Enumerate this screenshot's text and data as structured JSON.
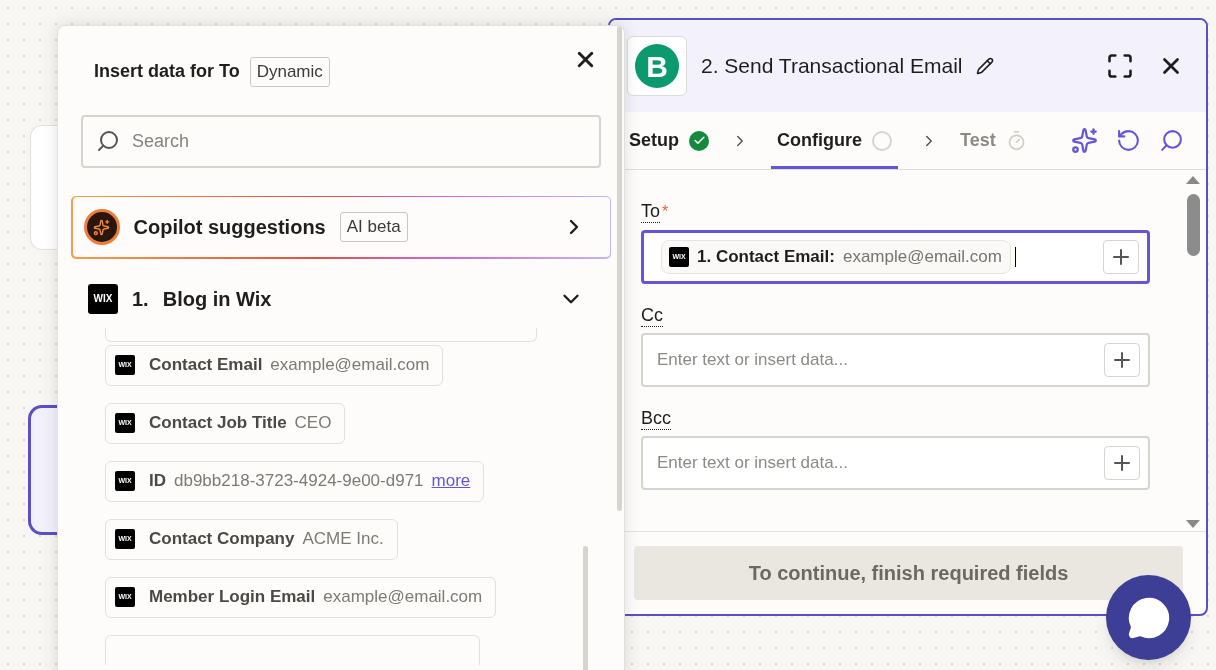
{
  "insert_panel": {
    "title": "Insert data for To",
    "badge": "Dynamic",
    "search": {
      "placeholder": "Search"
    },
    "copilot": {
      "label": "Copilot suggestions",
      "badge": "AI beta"
    },
    "source": {
      "app_logo": "WIX",
      "number": "1.",
      "name": "Blog in Wix",
      "expanded": true
    },
    "items": [
      {
        "app_logo": "WIX",
        "label": "Contact Email",
        "value": "example@email.com"
      },
      {
        "app_logo": "WIX",
        "label": "Contact Job Title",
        "value": "CEO"
      },
      {
        "app_logo": "WIX",
        "label": "ID",
        "value": "db9bb218-3723-4924-9e00-d971",
        "link": "more"
      },
      {
        "app_logo": "WIX",
        "label": "Contact Company",
        "value": "ACME Inc."
      },
      {
        "app_logo": "WIX",
        "label": "Member Login Email",
        "value": "example@email.com"
      }
    ]
  },
  "step_panel": {
    "app_logo": "B",
    "title": "2. Send Transactional Email",
    "tabs": [
      {
        "label": "Setup",
        "kind": "done",
        "selected": false
      },
      {
        "label": "Configure",
        "kind": "pending",
        "selected": true
      },
      {
        "label": "Test",
        "kind": "waiting",
        "selected": false
      }
    ],
    "fields": [
      {
        "label": "To",
        "required_mark": "*",
        "focused": true,
        "chip": {
          "app_logo": "WIX",
          "label": "1. Contact Email:",
          "value": "example@email.com"
        }
      },
      {
        "label": "Cc",
        "focused": false,
        "placeholder": "Enter text or insert data..."
      },
      {
        "label": "Bcc",
        "focused": false,
        "placeholder": "Enter text or insert data..."
      }
    ],
    "continue_button": {
      "label": "To continue, finish required fields",
      "disabled": true
    }
  }
}
